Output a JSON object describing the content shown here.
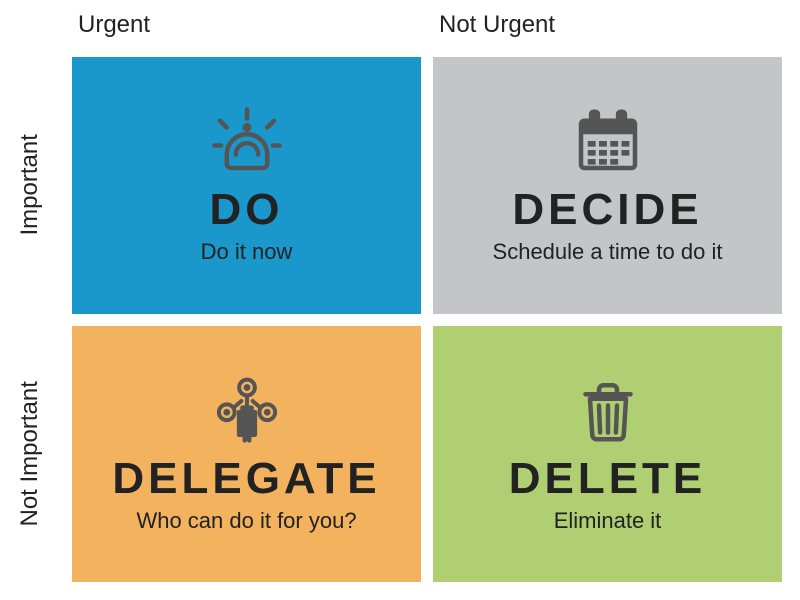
{
  "axes": {
    "col1": "Urgent",
    "col2": "Not Urgent",
    "row1": "Important",
    "row2": "Not Important"
  },
  "quadrants": {
    "q1": {
      "title": "DO",
      "subtitle": "Do it now",
      "icon": "alarm-icon",
      "color": "#1A98CC"
    },
    "q2": {
      "title": "DECIDE",
      "subtitle": "Schedule a time to do it",
      "icon": "calendar-icon",
      "color": "#C3C5C8"
    },
    "q3": {
      "title": "DELEGATE",
      "subtitle": "Who can do it for you?",
      "icon": "people-icon",
      "color": "#F3B25E"
    },
    "q4": {
      "title": "DELETE",
      "subtitle": "Eliminate it",
      "icon": "trash-icon",
      "color": "#B0CE72"
    }
  },
  "chart_data": {
    "type": "table",
    "title": "",
    "columns": [
      "Urgent",
      "Not Urgent"
    ],
    "rows": [
      "Important",
      "Not Important"
    ],
    "cells": [
      [
        {
          "action": "DO",
          "description": "Do it now"
        },
        {
          "action": "DECIDE",
          "description": "Schedule a time to do it"
        }
      ],
      [
        {
          "action": "DELEGATE",
          "description": "Who can do it for you?"
        },
        {
          "action": "DELETE",
          "description": "Eliminate it"
        }
      ]
    ]
  }
}
